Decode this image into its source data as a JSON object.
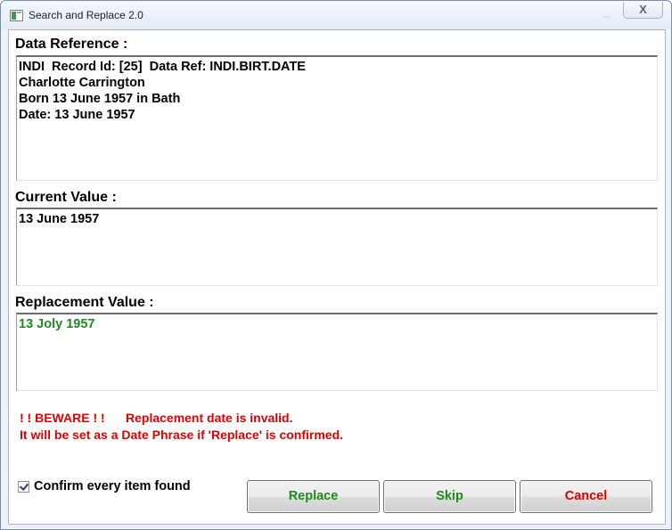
{
  "window": {
    "title": "Search and Replace 2.0",
    "minimize_glyph": "_",
    "close_glyph": "X"
  },
  "data_reference": {
    "label": "Data Reference :",
    "lines": [
      "INDI  Record Id: [25]  Data Ref: INDI.BIRT.DATE",
      "Charlotte Carrington",
      "Born 13 June 1957 in Bath",
      "Date: 13 June 1957"
    ]
  },
  "current_value": {
    "label": "Current Value :",
    "value": "13 June 1957"
  },
  "replacement_value": {
    "label": "Replacement Value :",
    "value": "13 Joly 1957"
  },
  "warning": {
    "line1": "! ! BEWARE ! !      Replacement date is invalid.",
    "line2": "It will be set as a Date Phrase if 'Replace' is confirmed."
  },
  "confirm": {
    "label": "Confirm every item found",
    "checked": true
  },
  "buttons": {
    "replace": "Replace",
    "skip": "Skip",
    "cancel": "Cancel"
  },
  "colors": {
    "green_text": "#1f8a1f",
    "red_text": "#e00000"
  }
}
